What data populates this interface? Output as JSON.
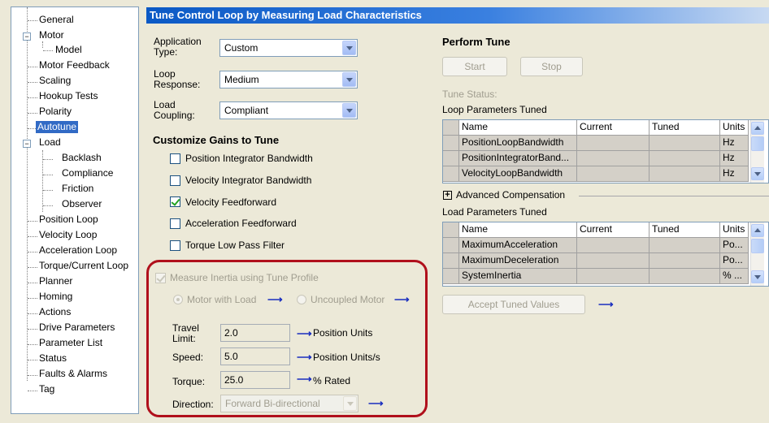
{
  "tree": {
    "items": [
      {
        "label": "General"
      },
      {
        "label": "Motor"
      },
      {
        "label": "Model"
      },
      {
        "label": "Motor Feedback"
      },
      {
        "label": "Scaling"
      },
      {
        "label": "Hookup Tests"
      },
      {
        "label": "Polarity"
      },
      {
        "label": "Autotune",
        "selected": true
      },
      {
        "label": "Load"
      },
      {
        "label": "Backlash"
      },
      {
        "label": "Compliance"
      },
      {
        "label": "Friction"
      },
      {
        "label": "Observer"
      },
      {
        "label": "Position Loop"
      },
      {
        "label": "Velocity Loop"
      },
      {
        "label": "Acceleration Loop"
      },
      {
        "label": "Torque/Current Loop"
      },
      {
        "label": "Planner"
      },
      {
        "label": "Homing"
      },
      {
        "label": "Actions"
      },
      {
        "label": "Drive Parameters"
      },
      {
        "label": "Parameter List"
      },
      {
        "label": "Status"
      },
      {
        "label": "Faults & Alarms"
      },
      {
        "label": "Tag"
      }
    ]
  },
  "header": {
    "title": "Tune Control Loop by Measuring Load Characteristics"
  },
  "settings": {
    "application_type_label": "Application Type:",
    "application_type_value": "Custom",
    "loop_response_label": "Loop Response:",
    "loop_response_value": "Medium",
    "load_coupling_label": "Load Coupling:",
    "load_coupling_value": "Compliant"
  },
  "gains": {
    "heading": "Customize Gains to Tune",
    "options": [
      {
        "label": "Position Integrator Bandwidth",
        "checked": false
      },
      {
        "label": "Velocity Integrator Bandwidth",
        "checked": false
      },
      {
        "label": "Velocity Feedforward",
        "checked": true
      },
      {
        "label": "Acceleration Feedforward",
        "checked": false
      },
      {
        "label": "Torque Low Pass Filter",
        "checked": false
      }
    ]
  },
  "inertia": {
    "measure_label": "Measure Inertia using Tune Profile",
    "motor_with_load": "Motor with Load",
    "uncoupled_motor": "Uncoupled Motor",
    "travel_limit_label": "Travel Limit:",
    "travel_limit_value": "2.0",
    "travel_limit_units": "Position Units",
    "speed_label": "Speed:",
    "speed_value": "5.0",
    "speed_units": "Position Units/s",
    "torque_label": "Torque:",
    "torque_value": "25.0",
    "torque_units": "% Rated",
    "direction_label": "Direction:",
    "direction_value": "Forward Bi-directional"
  },
  "perform": {
    "heading": "Perform Tune",
    "start_label": "Start",
    "stop_label": "Stop",
    "tune_status_label": "Tune Status:",
    "loop_params_label": "Loop Parameters Tuned",
    "advanced_label": "Advanced Compensation",
    "load_params_label": "Load Parameters Tuned",
    "accept_label": "Accept Tuned Values"
  },
  "loop_table": {
    "headers": [
      "Name",
      "Current",
      "Tuned",
      "Units"
    ],
    "rows": [
      [
        "PositionLoopBandwidth",
        "",
        "",
        "Hz"
      ],
      [
        "PositionIntegratorBand...",
        "",
        "",
        "Hz"
      ],
      [
        "VelocityLoopBandwidth",
        "",
        "",
        "Hz"
      ]
    ]
  },
  "load_table": {
    "headers": [
      "Name",
      "Current",
      "Tuned",
      "Units"
    ],
    "rows": [
      [
        "MaximumAcceleration",
        "",
        "",
        "Po..."
      ],
      [
        "MaximumDeceleration",
        "",
        "",
        "Po..."
      ],
      [
        "SystemInertia",
        "",
        "",
        "% ..."
      ]
    ]
  },
  "colors": {
    "title_bar": "#0b59c5",
    "annotation_border": "#b0101c",
    "arrow": "#1a2fbf",
    "selection": "#316ac5"
  }
}
